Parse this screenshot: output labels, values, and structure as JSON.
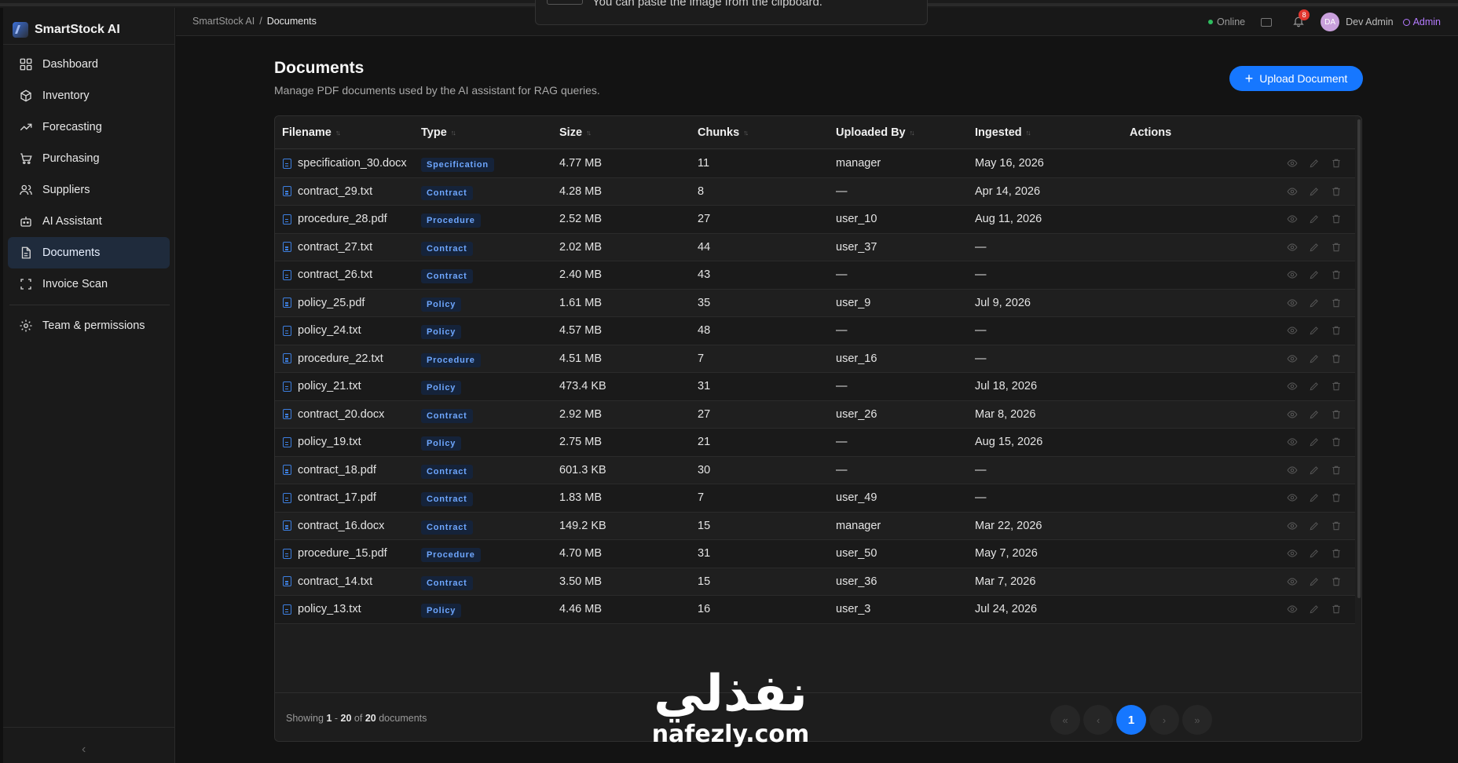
{
  "toast": {
    "text": "You can paste the image from the clipboard."
  },
  "app": {
    "name": "SmartStock AI"
  },
  "sidebar": {
    "items": [
      {
        "label": "Dashboard",
        "icon": "dashboard-icon"
      },
      {
        "label": "Inventory",
        "icon": "box-icon"
      },
      {
        "label": "Forecasting",
        "icon": "trend-icon"
      },
      {
        "label": "Purchasing",
        "icon": "cart-icon"
      },
      {
        "label": "Suppliers",
        "icon": "users-icon"
      },
      {
        "label": "AI Assistant",
        "icon": "bot-icon"
      },
      {
        "label": "Documents",
        "icon": "document-icon",
        "active": true
      },
      {
        "label": "Invoice Scan",
        "icon": "scan-icon"
      }
    ],
    "team_item": {
      "label": "Team & permissions",
      "icon": "gear-icon"
    },
    "collapse_label": "‹"
  },
  "header": {
    "breadcrumb": [
      "SmartStock AI",
      "/",
      "Documents"
    ],
    "status": "Online",
    "notification_count": "8",
    "avatar_initials": "DA",
    "user_name": "Dev Admin",
    "role": "Admin"
  },
  "page": {
    "title": "Documents",
    "subtitle": "Manage PDF documents used by the AI assistant for RAG queries.",
    "upload_label": "Upload Document"
  },
  "table": {
    "columns": [
      "Filename",
      "Type",
      "Size",
      "Chunks",
      "Uploaded By",
      "Ingested",
      "Actions"
    ],
    "rows": [
      [
        "specification_30.docx",
        "Specification",
        "4.77 MB",
        "11",
        "manager",
        "May 16, 2026"
      ],
      [
        "contract_29.txt",
        "Contract",
        "4.28 MB",
        "8",
        "—",
        "Apr 14, 2026"
      ],
      [
        "procedure_28.pdf",
        "Procedure",
        "2.52 MB",
        "27",
        "user_10",
        "Aug 11, 2026"
      ],
      [
        "contract_27.txt",
        "Contract",
        "2.02 MB",
        "44",
        "user_37",
        "—"
      ],
      [
        "contract_26.txt",
        "Contract",
        "2.40 MB",
        "43",
        "—",
        "—"
      ],
      [
        "policy_25.pdf",
        "Policy",
        "1.61 MB",
        "35",
        "user_9",
        "Jul 9, 2026"
      ],
      [
        "policy_24.txt",
        "Policy",
        "4.57 MB",
        "48",
        "—",
        "—"
      ],
      [
        "procedure_22.txt",
        "Procedure",
        "4.51 MB",
        "7",
        "user_16",
        "—"
      ],
      [
        "policy_21.txt",
        "Policy",
        "473.4 KB",
        "31",
        "—",
        "Jul 18, 2026"
      ],
      [
        "contract_20.docx",
        "Contract",
        "2.92 MB",
        "27",
        "user_26",
        "Mar 8, 2026"
      ],
      [
        "policy_19.txt",
        "Policy",
        "2.75 MB",
        "21",
        "—",
        "Aug 15, 2026"
      ],
      [
        "contract_18.pdf",
        "Contract",
        "601.3 KB",
        "30",
        "—",
        "—"
      ],
      [
        "contract_17.pdf",
        "Contract",
        "1.83 MB",
        "7",
        "user_49",
        "—"
      ],
      [
        "contract_16.docx",
        "Contract",
        "149.2 KB",
        "15",
        "manager",
        "Mar 22, 2026"
      ],
      [
        "procedure_15.pdf",
        "Procedure",
        "4.70 MB",
        "31",
        "user_50",
        "May 7, 2026"
      ],
      [
        "contract_14.txt",
        "Contract",
        "3.50 MB",
        "15",
        "user_36",
        "Mar 7, 2026"
      ],
      [
        "policy_13.txt",
        "Policy",
        "4.46 MB",
        "16",
        "user_3",
        "Jul 24, 2026"
      ]
    ],
    "action_icons": [
      "eye-icon",
      "pencil-icon",
      "trash-icon"
    ]
  },
  "footer": {
    "showing_prefix": "Showing",
    "range_start": "1",
    "range_sep": "-",
    "range_end": "20",
    "of": "of",
    "total": "20",
    "unit": "documents",
    "current_page": "1",
    "pager_icons": [
      "«",
      "‹",
      "›",
      "»"
    ]
  },
  "watermark": {
    "arabic": "نفذلي",
    "latin": "nafezly.com"
  },
  "colors": {
    "accent": "#1677ff",
    "active_nav_bg": "#1f2b3c",
    "tag_text": "#6ea7ff",
    "role": "#b57bff",
    "online": "#2ebd5f",
    "badge": "#e2362f"
  }
}
